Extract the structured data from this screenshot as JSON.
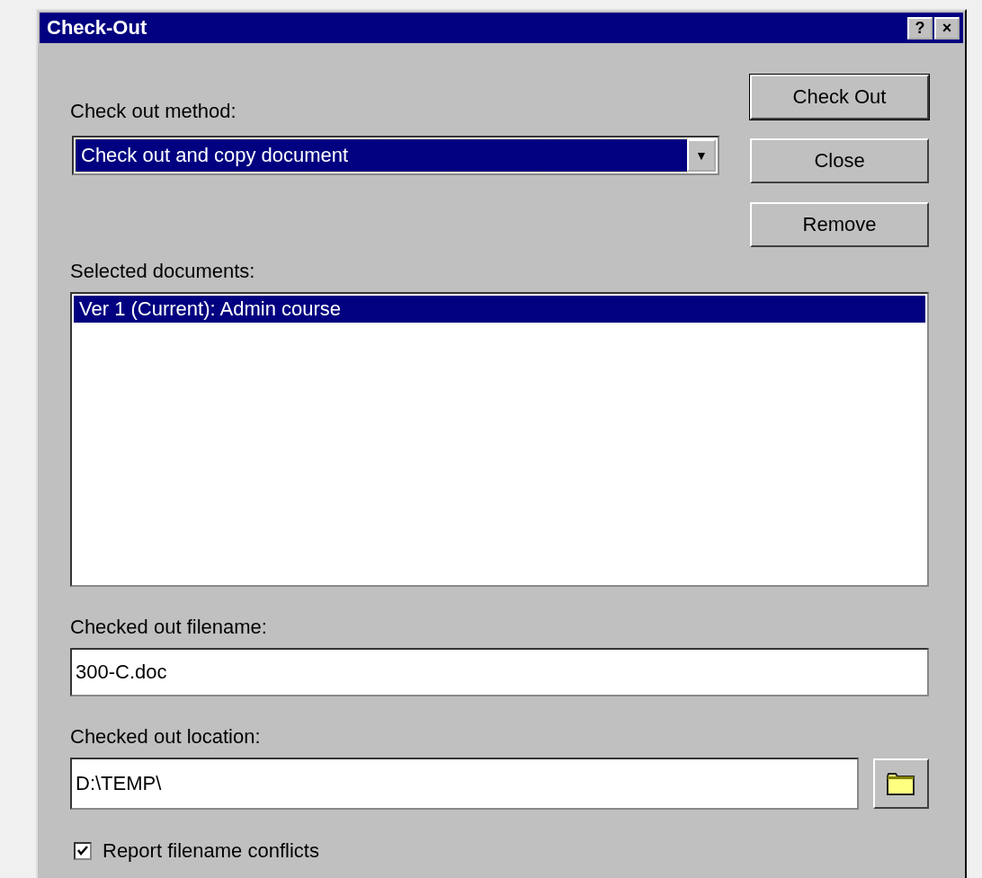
{
  "window": {
    "title": "Check-Out",
    "title_buttons": [
      "?",
      "×"
    ]
  },
  "method": {
    "label": "Check out method:",
    "value": "Check out and copy document",
    "arrow": "▼"
  },
  "buttons": [
    "Check Out",
    "Close",
    "Remove"
  ],
  "documents": {
    "label": "Selected documents:",
    "items": [
      {
        "text": "Ver 1 (Current): Admin course",
        "selected": true
      }
    ]
  },
  "filename": {
    "label": "Checked out filename:",
    "value": "300-C.doc"
  },
  "location": {
    "label": "Checked out location:",
    "value": "D:\\TEMP\\"
  },
  "report": {
    "label": "Report filename conflicts",
    "checked": true
  }
}
